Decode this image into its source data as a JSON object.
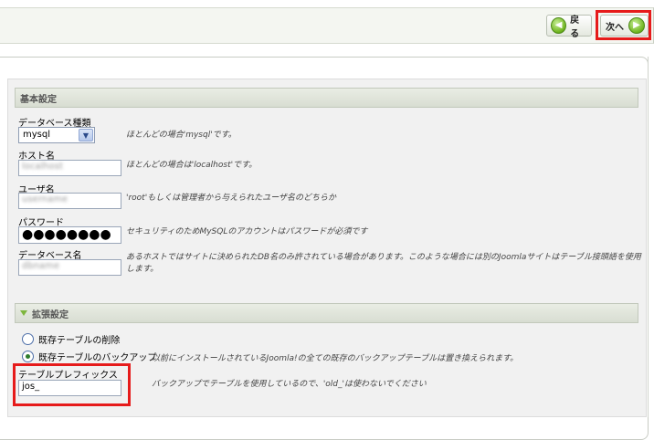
{
  "toolbar": {
    "back_label": "戻る",
    "next_label": "次へ"
  },
  "basic_settings": {
    "header": "基本設定",
    "db_type": {
      "label": "データベース種類",
      "value": "mysql",
      "hint": "ほとんどの場合'mysql'です。"
    },
    "host": {
      "label": "ホスト名",
      "value": "localhost",
      "hint": "ほとんどの場合は'localhost'です。"
    },
    "user": {
      "label": "ユーザ名",
      "value": "username",
      "hint": "'root'もしくは管理者から与えられたユーザ名のどちらか"
    },
    "password": {
      "label": "パスワード",
      "value": "●●●●●●●●",
      "hint": "セキュリティのためMySQLのアカウントはパスワードが必須です"
    },
    "db_name": {
      "label": "データベース名",
      "value": "dbname",
      "hint": "あるホストではサイトに決められたDB名のみ許されている場合があります。このような場合には別のJoomlaサイトはテーブル接頭語を使用します。"
    }
  },
  "advanced_settings": {
    "header": "拡張設定",
    "options": [
      {
        "label": "既存テーブルの削除",
        "checked": false
      },
      {
        "label": "既存テーブルのバックアップ",
        "checked": true
      }
    ],
    "backup_hint": "以前にインストールされているJoomla!の全ての既存のバックアップテーブルは置き換えられます。",
    "prefix": {
      "label": "テーブルプレフィックス",
      "value": "jos_",
      "hint": "バックアップでテーブルを使用しているので、'old_'は使わないでください"
    }
  }
}
